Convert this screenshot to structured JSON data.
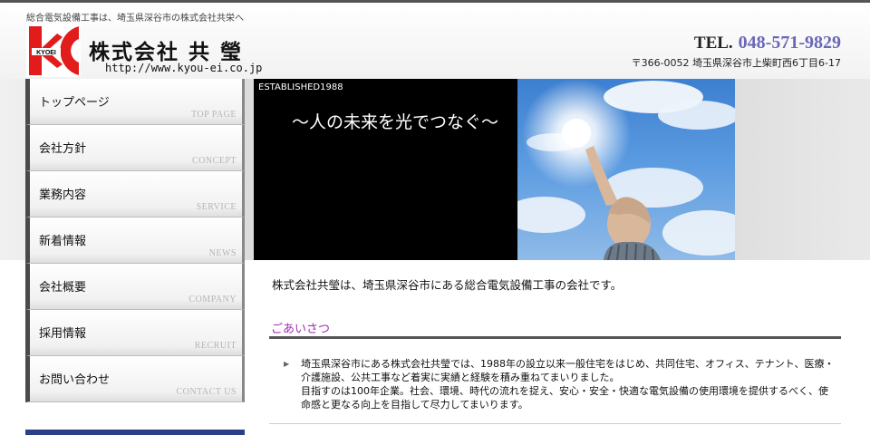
{
  "header": {
    "tagline": "総合電気設備工事は、埼玉県深谷市の株式会社共栄へ",
    "logo_text": "KYOEI",
    "company_name": "株式会社 共 瑩",
    "url": "http://www.kyou-ei.co.jp",
    "tel_label": "TEL.",
    "tel_number": "048-571-9829",
    "address": "〒366-0052 埼玉県深谷市上柴町西6丁目6-17"
  },
  "nav": {
    "items": [
      {
        "label": "トップページ",
        "sub": "TOP PAGE"
      },
      {
        "label": "会社方針",
        "sub": "CONCEPT"
      },
      {
        "label": "業務内容",
        "sub": "SERVICE"
      },
      {
        "label": "新着情報",
        "sub": "NEWS"
      },
      {
        "label": "会社概要",
        "sub": "COMPANY"
      },
      {
        "label": "採用情報",
        "sub": "RECRUIT"
      },
      {
        "label": "お問い合わせ",
        "sub": "CONTACT US"
      }
    ]
  },
  "hero": {
    "established": "ESTABLISHED1988",
    "catchphrase": "～人の未来を光でつなぐ～"
  },
  "main": {
    "intro": "株式会社共瑩は、埼玉県深谷市にある総合電気設備工事の会社です。",
    "greeting_title": "ごあいさつ",
    "greeting_p1": "埼玉県深谷市にある株式会社共瑩では、1988年の設立以来一般住宅をはじめ、共同住宅、オフィス、テナント、医療・介護施設、公共工事など着実に実績と経験を積み重ねてまいりました。",
    "greeting_p2": "目指すのは100年企業。社会、環境、時代の流れを捉え、安心・安全・快適な電気設備の使用環境を提供するべく、使命感と更なる向上を目指して尽力してまいります。"
  },
  "colors": {
    "accent_purple": "#a02cb6",
    "tel_blue": "#6a67b8",
    "logo_red": "#e21b1b",
    "sidebar_bottom": "#2b3f87"
  }
}
